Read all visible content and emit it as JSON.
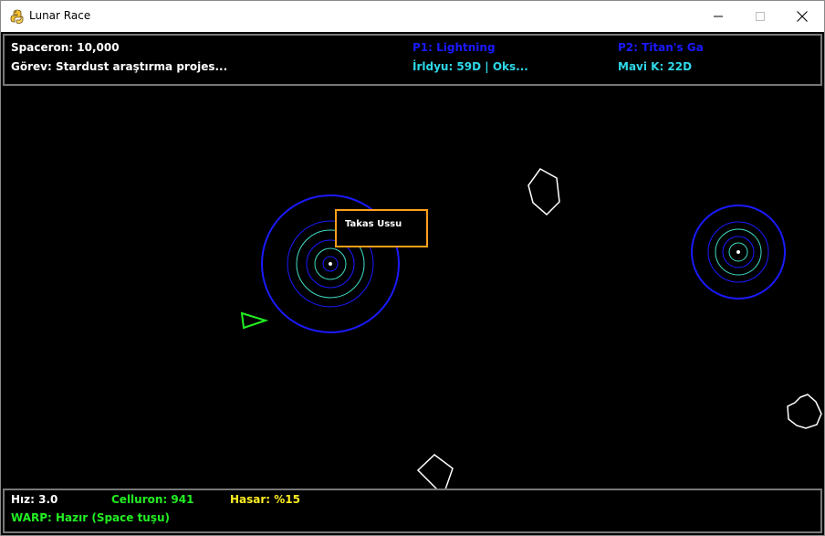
{
  "window": {
    "title": "Lunar Race"
  },
  "hud_top": {
    "spaceron": "Spaceron: 10,000",
    "mission": "Görev: Stardust araştırma projes...",
    "p1": "P1: Lightning",
    "p1_detail": "İrldyu: 59D | Oks...",
    "p2": "P2: Titan's Ga",
    "p2_detail": "Mavi K: 22D"
  },
  "hud_bottom": {
    "speed": "Hız: 3.0",
    "celluron": "Celluron: 941",
    "damage": "Hasar: %15",
    "warp": "WARP: Hazır (Space tuşu)"
  },
  "station": {
    "label": "Takas Ussu"
  },
  "colors": {
    "ring_blue": "#1a1aff",
    "ring_cyan": "#3fe0c8",
    "player_ship": "#22ee22",
    "label_border": "#ff9f1a",
    "asteroid": "#ffffff",
    "hud_border": "#787878"
  },
  "icons": {
    "app": "python-snake-icon",
    "minimize": "minimize-icon",
    "maximize": "maximize-icon",
    "close": "close-icon"
  }
}
